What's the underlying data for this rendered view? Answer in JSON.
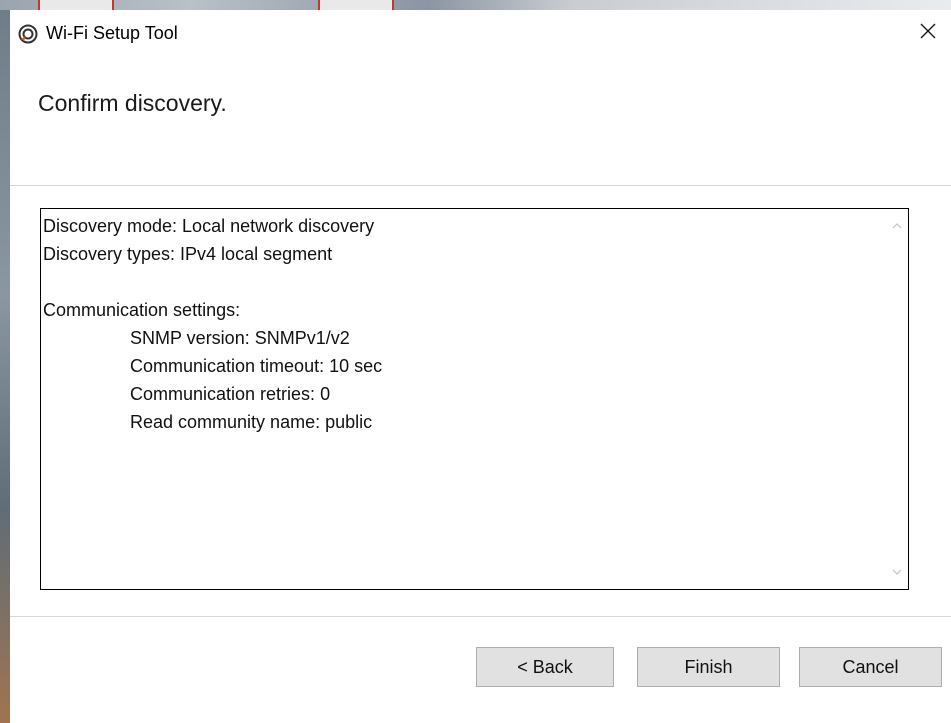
{
  "window": {
    "title": "Wi-Fi Setup Tool",
    "close_glyph": "✕"
  },
  "header": {
    "heading": "Confirm discovery."
  },
  "summary": {
    "lines": [
      {
        "text": "Discovery mode: Local network discovery",
        "indent": false
      },
      {
        "text": "Discovery types: IPv4 local segment",
        "indent": false
      },
      {
        "text": "",
        "indent": false
      },
      {
        "text": "Communication settings:",
        "indent": false
      },
      {
        "text": "SNMP version: SNMPv1/v2",
        "indent": true
      },
      {
        "text": "Communication timeout: 10 sec",
        "indent": true
      },
      {
        "text": "Communication retries: 0",
        "indent": true
      },
      {
        "text": "Read community name: public",
        "indent": true
      }
    ]
  },
  "buttons": {
    "back": "< Back",
    "finish": "Finish",
    "cancel": "Cancel"
  },
  "colors": {
    "accent": "#e05a1e",
    "button_bg": "#e1e1e1",
    "divider": "#d6d6d6"
  },
  "icons": {
    "app": "wifi-setup-app-icon",
    "close": "close-icon",
    "scroll_up": "scroll-up-arrow-icon",
    "scroll_down": "scroll-down-arrow-icon"
  }
}
